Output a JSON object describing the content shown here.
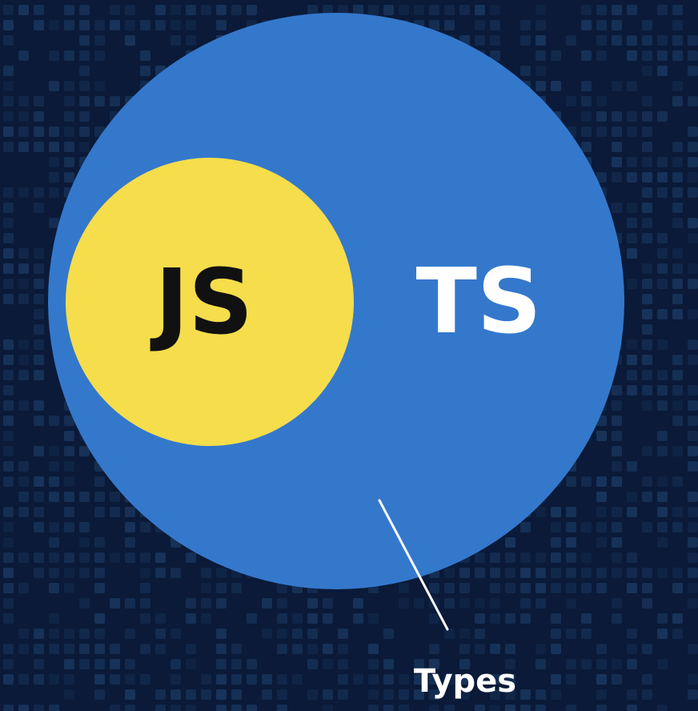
{
  "diagram": {
    "outer_circle": {
      "label": "TS",
      "fill": "#3478cc",
      "text_color": "#ffffff"
    },
    "inner_circle": {
      "label": "JS",
      "fill": "#f5dd4c",
      "text_color": "#111111"
    },
    "callout": {
      "label": "Types",
      "line_color": "#ffffff",
      "text_color": "#ffffff"
    }
  },
  "background": {
    "base_color": "#0a1a38",
    "tile_color": "#1c3a63"
  }
}
